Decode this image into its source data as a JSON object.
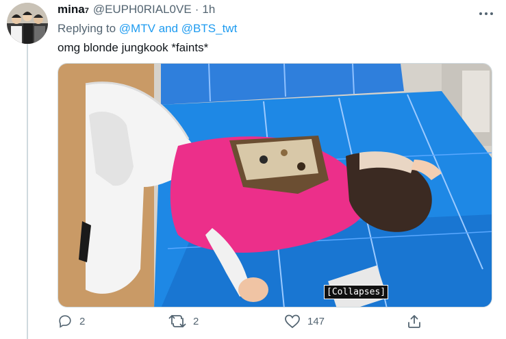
{
  "tweet": {
    "display_name": "mina",
    "name_superscript": "7",
    "handle": "@EUPH0RIAL0VE",
    "separator": "·",
    "time": "1h",
    "replying_prefix": "Replying to",
    "reply_user_1": "@MTV",
    "reply_and": "and",
    "reply_user_2": "@BTS_twt",
    "text": "omg blonde jungkook *faints*",
    "media_caption": "[Collapses]"
  },
  "actions": {
    "reply_count": "2",
    "retweet_count": "2",
    "like_count": "147",
    "share_count": ""
  },
  "icons": {
    "more": "more-options-icon",
    "reply": "reply-icon",
    "retweet": "retweet-icon",
    "like": "heart-icon",
    "share": "share-icon"
  },
  "colors": {
    "link": "#1d9bf0",
    "secondary_text": "#536471",
    "mat_blue": "#1e88e5",
    "shirt_pink": "#ec2f8a"
  }
}
